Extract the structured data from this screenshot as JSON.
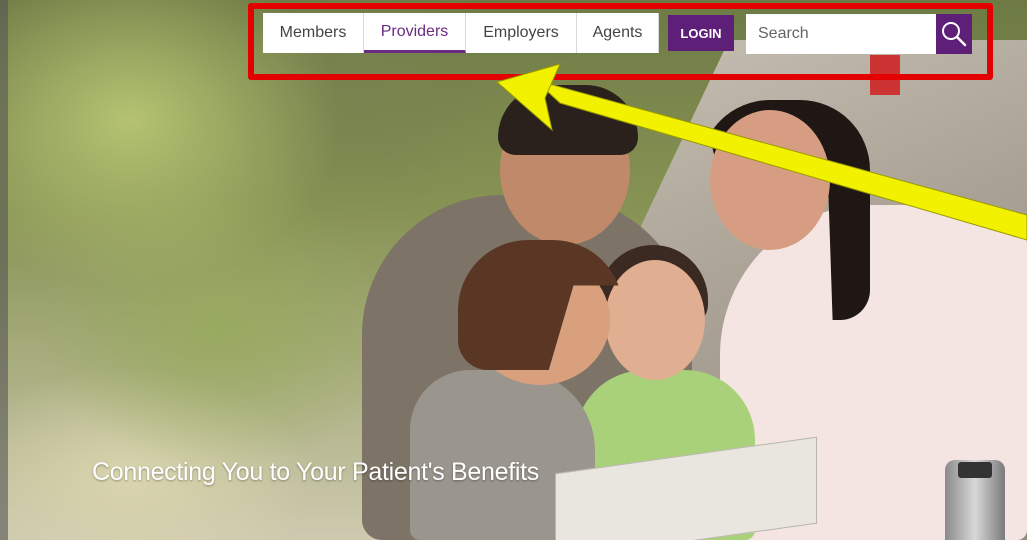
{
  "nav": {
    "items": [
      {
        "label": "Members"
      },
      {
        "label": "Providers"
      },
      {
        "label": "Employers"
      },
      {
        "label": "Agents"
      }
    ],
    "login_label": "LOGIN",
    "search_placeholder": "Search"
  },
  "hero": {
    "tagline": "Connecting You to Your Patient's Benefits"
  },
  "icons": {
    "search": "search-icon"
  },
  "colors": {
    "brand_purple": "#5e1f78",
    "active_text": "#6b2b82",
    "annotation_red": "#e30000",
    "annotation_yellow": "#f2f200"
  }
}
